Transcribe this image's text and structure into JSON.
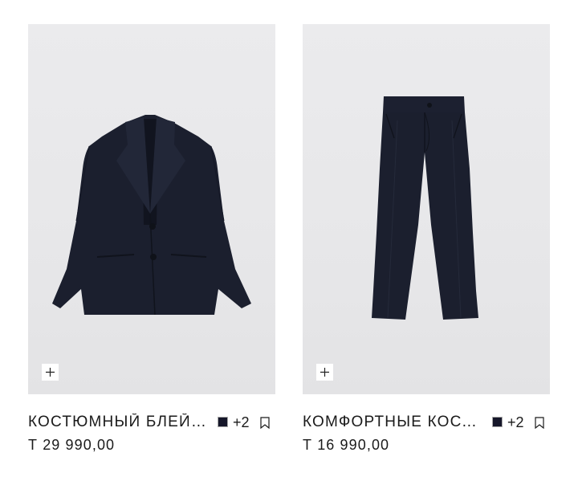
{
  "products": [
    {
      "name": "КОСТЮМНЫЙ БЛЕЙЗЕР",
      "price": "Т 29 990,00",
      "extra_colors": "+2",
      "swatch_color": "#16172a",
      "image_icon": "blazer-image",
      "add_icon": "plus-icon",
      "save_icon": "bookmark-icon"
    },
    {
      "name": "КОМФОРТНЫЕ КОСТЮМНЫЕ БРЮКИ",
      "price": "Т 16 990,00",
      "extra_colors": "+2",
      "swatch_color": "#16172a",
      "image_icon": "trousers-image",
      "add_icon": "plus-icon",
      "save_icon": "bookmark-icon"
    }
  ],
  "colors": {
    "garment": "#1a1e2c",
    "photo_bg": "#e9e9eb",
    "text": "#1a1a1a"
  }
}
